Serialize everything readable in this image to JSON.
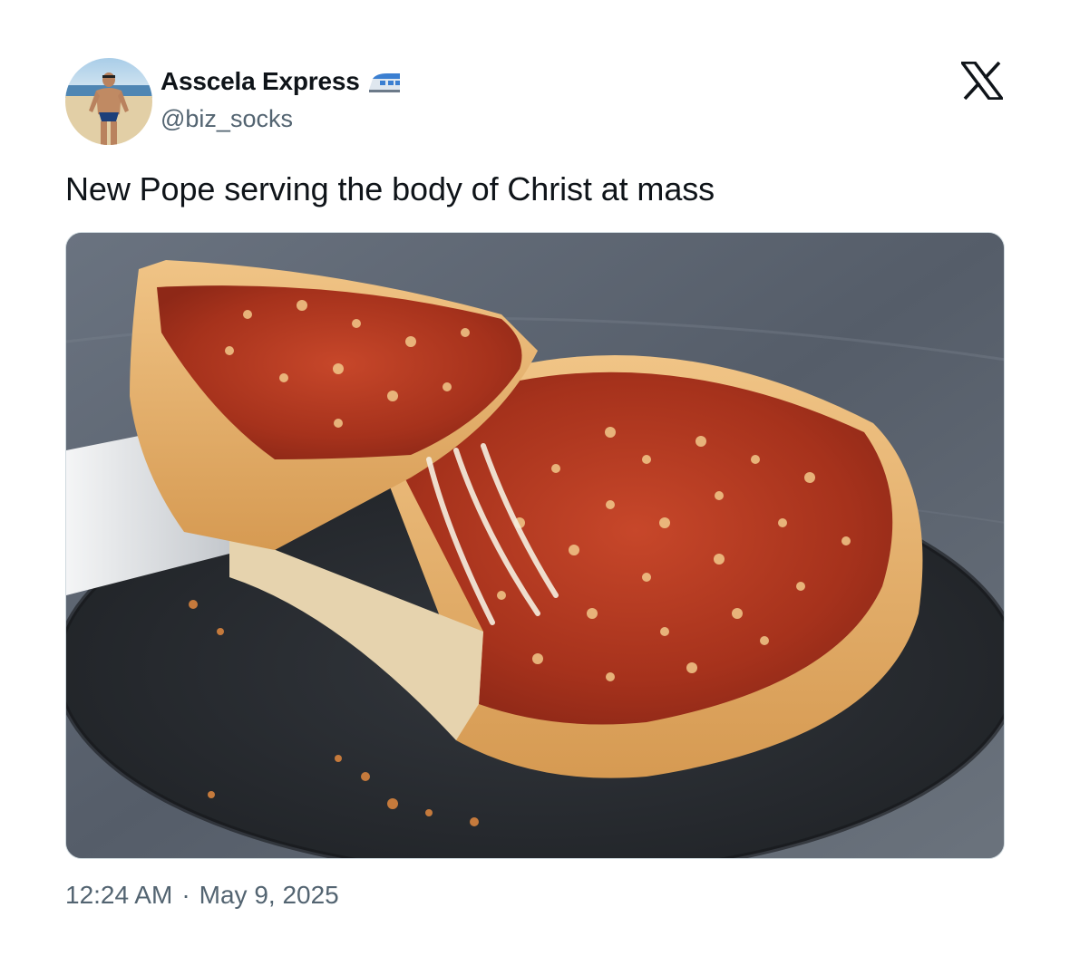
{
  "author": {
    "display_name": "Asscela Express",
    "badge_icon": "high-speed-train-emoji",
    "handle": "@biz_socks",
    "avatar_icon": "profile-photo-man-on-beach"
  },
  "platform": {
    "logo_icon": "x-logo",
    "logo_color": "#0f1419"
  },
  "tweet": {
    "text": "New Pope serving the body of Christ at mass",
    "media_description_icon": "deep-dish-pizza-photo",
    "time": "12:24 AM",
    "separator": "·",
    "date": "May 9, 2025"
  },
  "colors": {
    "text_primary": "#0f1419",
    "text_secondary": "#536471",
    "border": "#cfd9de",
    "background": "#ffffff"
  }
}
